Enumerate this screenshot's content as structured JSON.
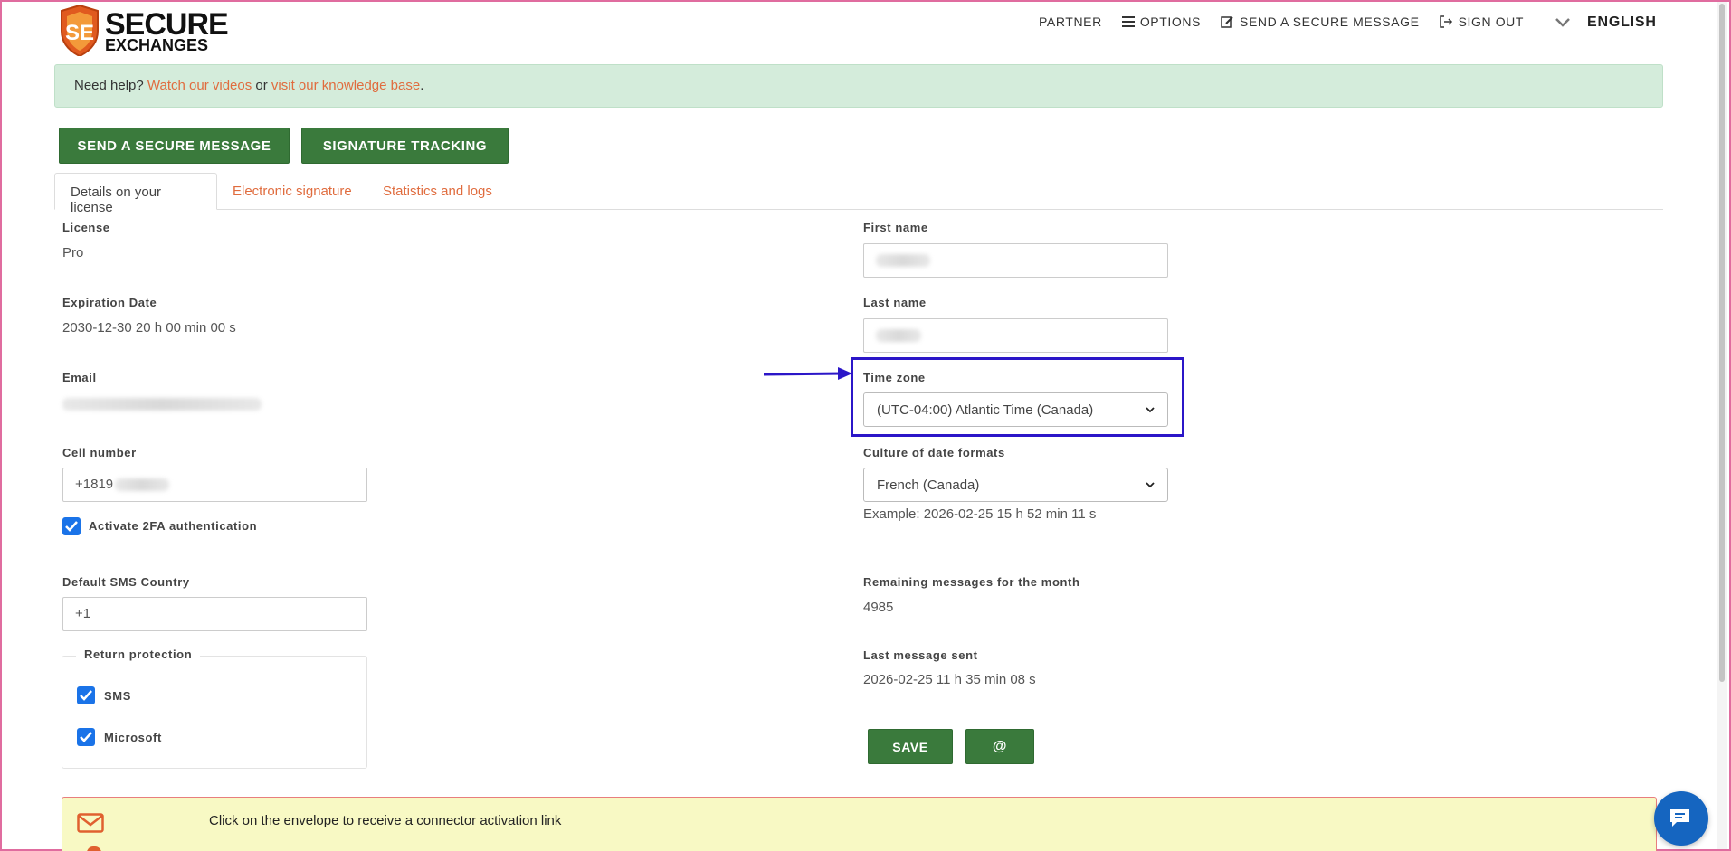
{
  "logo": {
    "line1": "SECURE",
    "line2": "EXCHANGES"
  },
  "topnav": {
    "partner": "PARTNER",
    "options": "OPTIONS",
    "send": "SEND A SECURE MESSAGE",
    "signout": "SIGN OUT",
    "language": "ENGLISH"
  },
  "help": {
    "prefix": "Need help?",
    "videos": "Watch our videos",
    "or": "or",
    "kb": "visit our knowledge base",
    "suffix": "."
  },
  "buttons": {
    "send": "SEND A SECURE MESSAGE",
    "signature": "SIGNATURE TRACKING",
    "save": "SAVE",
    "at": "@"
  },
  "tabs": {
    "details": "Details on your license",
    "esign": "Electronic signature",
    "stats": "Statistics and logs"
  },
  "left": {
    "license_label": "License",
    "license_value": "Pro",
    "expiration_label": "Expiration Date",
    "expiration_value": "2030-12-30 20 h 00 min 00 s",
    "email_label": "Email",
    "cell_label": "Cell number",
    "cell_value": "+1819",
    "twofa_label": "Activate 2FA authentication",
    "sms_country_label": "Default SMS Country",
    "sms_country_value": "+1",
    "return_protection_label": "Return protection",
    "sms_label": "SMS",
    "microsoft_label": "Microsoft"
  },
  "right": {
    "first_name_label": "First name",
    "last_name_label": "Last name",
    "timezone_label": "Time zone",
    "timezone_value": "(UTC-04:00) Atlantic Time (Canada)",
    "culture_label": "Culture of date formats",
    "culture_value": "French (Canada)",
    "example": "Example: 2026-02-25 15 h 52 min 11 s",
    "remaining_label": "Remaining messages for the month",
    "remaining_value": "4985",
    "last_sent_label": "Last message sent",
    "last_sent_value": "2026-02-25 11 h 35 min 08 s"
  },
  "connector": {
    "text": "Click on the envelope to receive a connector activation link"
  },
  "colors": {
    "accent_green": "#3a7a3c",
    "link_orange": "#e06c3e",
    "highlight": "#2b16c8",
    "checkbox": "#1a73e8"
  }
}
